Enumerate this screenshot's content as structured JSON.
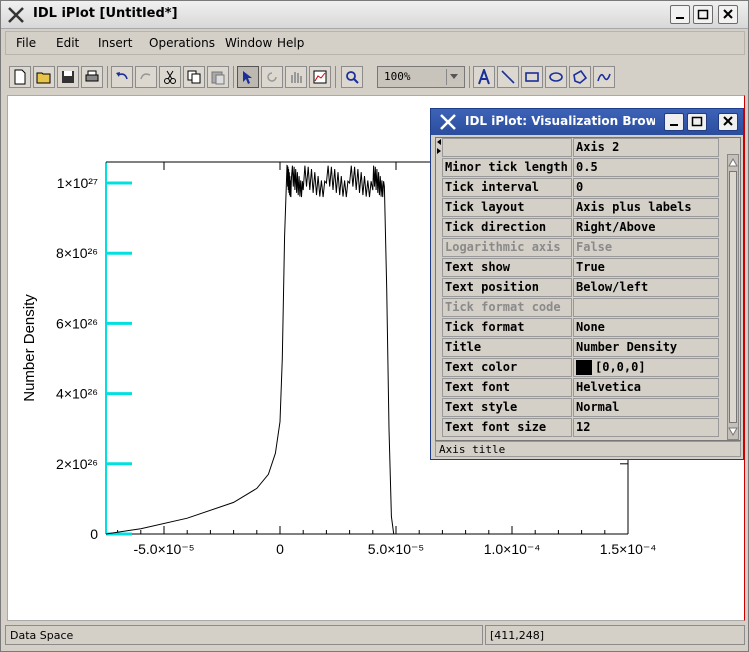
{
  "window": {
    "title": "IDL iPlot [Untitled*]"
  },
  "menubar": {
    "items": [
      "File",
      "Edit",
      "Insert",
      "Operations",
      "Window",
      "Help"
    ]
  },
  "toolbar": {
    "icons": [
      "new-icon",
      "open-icon",
      "save-icon",
      "print-icon",
      "undo-icon",
      "redo-icon",
      "cut-icon",
      "copy-icon",
      "paste-icon",
      "select-arrow-icon",
      "rotate-icon",
      "pan-hand-icon",
      "data-range-icon",
      "zoom-icon",
      "text-icon",
      "line-icon",
      "rectangle-icon",
      "oval-icon",
      "polygon-icon",
      "freehand-icon"
    ],
    "zoom_value": "100%"
  },
  "chart_data": {
    "type": "line",
    "title": "",
    "xlabel": "",
    "ylabel": "Number Density",
    "xlim": [
      -7.5e-05,
      0.00015
    ],
    "ylim": [
      0,
      1.06e+27
    ],
    "x_ticks": [
      "-5.0×10⁻⁵",
      "0",
      "5.0×10⁻⁵",
      "1.0×10⁻⁴",
      "1.5×10⁻⁴"
    ],
    "y_ticks": [
      "0",
      "2×10²⁶",
      "4×10²⁶",
      "6×10²⁶",
      "8×10²⁶",
      "1×10²⁷"
    ],
    "series": [
      {
        "x": [
          -7.5e-05,
          -6e-05,
          -4e-05,
          -2e-05,
          -1e-05,
          -5e-06,
          -2e-06,
          0,
          1e-06,
          2e-06,
          3e-06,
          5e-06,
          1e-05,
          2e-05,
          3e-05,
          4e-05,
          4.5e-05,
          4.6e-05,
          4.7e-05,
          4.8e-05,
          4.9e-05,
          5.2e-05
        ],
        "y": [
          0,
          1.5e+25,
          4.5e+25,
          9e+25,
          1.3e+26,
          1.7e+26,
          2.3e+26,
          3.2e+26,
          5e+26,
          8.5e+26,
          1.05e+27,
          1.02e+27,
          9.8e+26,
          1e+27,
          1e+27,
          9.8e+26,
          9.9e+26,
          7e+26,
          3e+26,
          5e+25,
          0,
          0
        ]
      }
    ]
  },
  "status": {
    "left": "Data Space",
    "right": "[411,248]"
  },
  "browser": {
    "title": "IDL iPlot: Visualization Browser",
    "header_value": "Axis 2",
    "properties": [
      {
        "name": "Minor tick length",
        "value": "0.5"
      },
      {
        "name": "Tick interval",
        "value": "0"
      },
      {
        "name": "Tick layout",
        "value": "Axis plus labels"
      },
      {
        "name": "Tick direction",
        "value": "Right/Above"
      },
      {
        "name": "Logarithmic axis",
        "value": "False"
      },
      {
        "name": "Text show",
        "value": "True"
      },
      {
        "name": "Text position",
        "value": "Below/left"
      },
      {
        "name": "Tick format code",
        "value": ""
      },
      {
        "name": "Tick format",
        "value": "None"
      },
      {
        "name": "Title",
        "value": "Number Density"
      },
      {
        "name": "Text color",
        "value": "[0,0,0]"
      },
      {
        "name": "Text font",
        "value": "Helvetica"
      },
      {
        "name": "Text style",
        "value": "Normal"
      },
      {
        "name": "Text font size",
        "value": "12"
      }
    ],
    "description": "Axis title"
  },
  "colors": {
    "axis_tick_highlight": "#00e0e0",
    "browser_title": "#2a4d9e",
    "canvas_border": "#cc0000"
  }
}
